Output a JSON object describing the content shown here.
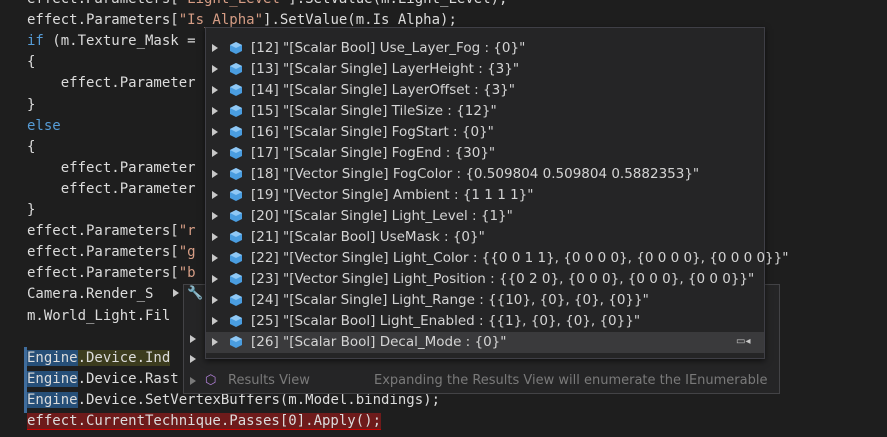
{
  "editor": {
    "lines": [
      {
        "segments": [
          {
            "t": "effect.Parameters[",
            "c": ""
          },
          {
            "t": "\"Light_Level\"",
            "c": "str"
          },
          {
            "t": "].SetValue(m.Light_Level);",
            "c": ""
          }
        ]
      },
      {
        "segments": [
          {
            "t": "effect.Parameters[",
            "c": ""
          },
          {
            "t": "\"Is_Alpha\"",
            "c": "str"
          },
          {
            "t": "].SetValue(m.Is_Alpha);",
            "c": ""
          }
        ]
      },
      {
        "segments": [
          {
            "t": "if",
            "c": "kw"
          },
          {
            "t": " (m.Texture_Mask =",
            "c": ""
          }
        ]
      },
      {
        "segments": [
          {
            "t": "{",
            "c": ""
          }
        ]
      },
      {
        "segments": [
          {
            "t": "    effect.Parameter",
            "c": ""
          }
        ]
      },
      {
        "segments": [
          {
            "t": "}",
            "c": ""
          }
        ]
      },
      {
        "segments": [
          {
            "t": "else",
            "c": "kw"
          }
        ]
      },
      {
        "segments": [
          {
            "t": "{",
            "c": ""
          }
        ]
      },
      {
        "segments": [
          {
            "t": "    effect.Parameter",
            "c": ""
          }
        ]
      },
      {
        "segments": [
          {
            "t": "    effect.Parameter",
            "c": ""
          }
        ]
      },
      {
        "segments": [
          {
            "t": "}",
            "c": ""
          }
        ]
      },
      {
        "segments": [
          {
            "t": "effect.Parameters[",
            "c": ""
          },
          {
            "t": "\"r",
            "c": "str"
          }
        ]
      },
      {
        "segments": [
          {
            "t": "effect.Parameters[",
            "c": ""
          },
          {
            "t": "\"g",
            "c": "str"
          }
        ]
      },
      {
        "segments": [
          {
            "t": "effect.Parameters[",
            "c": ""
          },
          {
            "t": "\"b",
            "c": "str"
          }
        ]
      },
      {
        "segments": [
          {
            "t": "Camera.Render_S",
            "c": ""
          }
        ]
      },
      {
        "segments": [
          {
            "t": "m.World_Light.Fil",
            "c": ""
          }
        ]
      },
      {
        "segments": []
      },
      {
        "segments": [
          {
            "t": "Engine",
            "c": "hl-blue"
          },
          {
            "t": ".Device.Ind",
            "c": "hl-yellow"
          }
        ]
      },
      {
        "segments": [
          {
            "t": "Engine",
            "c": "hl-blue"
          },
          {
            "t": ".Device.Rast",
            "c": ""
          }
        ]
      },
      {
        "segments": [
          {
            "t": "Engine",
            "c": "hl-blue"
          },
          {
            "t": ".Device.SetVertexBuffers(m.Model.bindings);",
            "c": ""
          }
        ]
      },
      {
        "segments": [
          {
            "t": "effect.CurrentTechnique.Passes[0].Apply();",
            "c": "hl-red"
          }
        ]
      }
    ]
  },
  "datatip": {
    "rows": [
      "[12]  \"[Scalar Bool] Use_Layer_Fog : {0}\"",
      "[13]  \"[Scalar Single] LayerHeight : {3}\"",
      "[14]  \"[Scalar Single] LayerOffset : {3}\"",
      "[15]  \"[Scalar Single] TileSize : {12}\"",
      "[16]  \"[Scalar Single] FogStart : {0}\"",
      "[17]  \"[Scalar Single] FogEnd : {30}\"",
      "[18]  \"[Vector Single] FogColor : {0.509804 0.509804 0.5882353}\"",
      "[19]  \"[Vector Single] Ambient : {1 1 1 1}\"",
      "[20]  \"[Scalar Single] Light_Level : {1}\"",
      "[21]  \"[Scalar Bool] UseMask : {0}\"",
      "[22]  \"[Vector Single] Light_Color : {{0 0 1 1}, {0 0 0 0}, {0 0 0 0}, {0 0 0 0}}\"",
      "[23]  \"[Vector Single] Light_Position : {{0 2 0}, {0 0 0}, {0 0 0}, {0 0 0}}\"",
      "[24]  \"[Scalar Single] Light_Range : {{10}, {0}, {0}, {0}}\"",
      "[25]  \"[Scalar Bool] Light_Enabled : {{1}, {0}, {0}, {0}}\"",
      "[26]  \"[Scalar Bool] Decal_Mode : {0}\""
    ],
    "selected_index": 14
  },
  "results_view": {
    "label": "Results View",
    "hint": "Expanding the Results View will enumerate the IEnumerable"
  },
  "colors": {
    "field_icon": "#4a9de0",
    "selection": "#3a3a3c"
  }
}
